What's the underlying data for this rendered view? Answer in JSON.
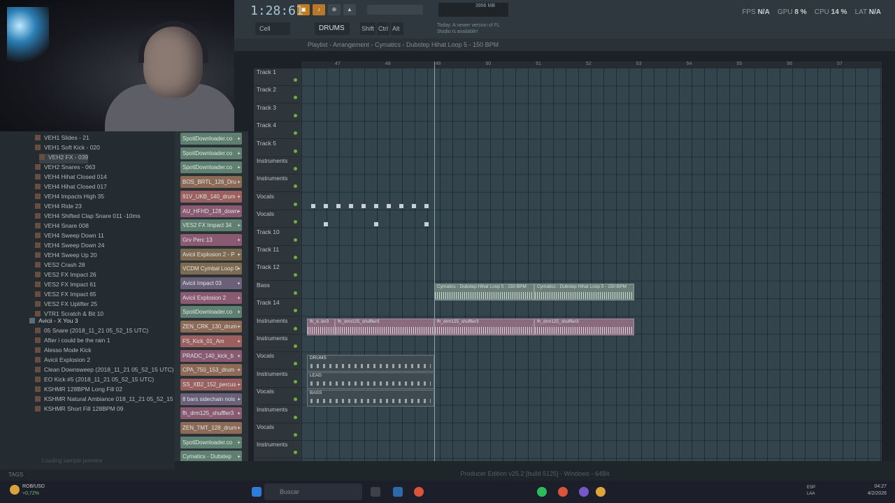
{
  "toolbar": {
    "time": "1:28:61",
    "pattern": "DRUMS",
    "cell": "Cell",
    "news": "Today: A newer version of FL Studio is available!",
    "fps_label": "FPS",
    "fps_value": "N/A",
    "gpu_label": "GPU",
    "gpu_value": "8 %",
    "cpu_label": "CPU",
    "cpu_value": "14 %",
    "lat_label": "LAT",
    "lat_value": "N/A",
    "mem": "3956 MB",
    "shift": "Shift",
    "ctrl": "Ctrl",
    "alt": "Alt"
  },
  "browser": {
    "items": [
      "VEH1 Slides - 21",
      "VEH1 Soft Kick - 020",
      "VEH2 FX - 039",
      "VEH2 Snares - 063",
      "VEH4 Hihat Closed 014",
      "VEH4 Hihat Closed 017",
      "VEH4 Impacts High 35",
      "VEH4 Ride 23",
      "VEH4 Shifted Clap Snare 011 -10ms",
      "VEH4 Snare 008",
      "VEH4 Sweep Down 11",
      "VEH4 Sweep Down 24",
      "VEH4 Sweep Up 20",
      "VES2 Crash 28",
      "VES2 FX Impact 26",
      "VES2 FX Impact 61",
      "VES2 FX Impact 65",
      "VES2 FX Uplifter 25",
      "VTR1 Scratch & Bit 10"
    ],
    "folder": "Avicii - X You 3",
    "folder_items": [
      "05 Snare (2018_11_21 05_52_15 UTC)",
      "After i could be the rain 1",
      "Alesso Mode Kick",
      "Avicii Explosion 2",
      "Clean Downsweep (2018_11_21 05_52_15 UTC)",
      "EO Kick #5 (2018_11_21 05_52_15 UTC)",
      "KSHMR 128BPM Long Fill 02",
      "KSHMR Natural Ambiance 018_11_21 05_52_15 UTC)",
      "KSHMR Short Fill 128BPM 09"
    ],
    "footer": "TAGS",
    "loading": "Loading sample preview"
  },
  "rack": {
    "channels": [
      {
        "label": "SpotiDownloader.co",
        "color": "#5f7f70"
      },
      {
        "label": "SpotiDownloader.co",
        "color": "#5f7f70"
      },
      {
        "label": "SpotiDownloader.co",
        "color": "#5f7f70"
      },
      {
        "label": "BOS_BRTL_126_Dru",
        "color": "#8c6a55"
      },
      {
        "label": "91V_UKB_140_drum",
        "color": "#9a5f5f"
      },
      {
        "label": "AU_HFHD_128_down",
        "color": "#8a5a70"
      },
      {
        "label": "VES2 FX Impact 34",
        "color": "#5f7f70"
      },
      {
        "label": "Grv Perc 13",
        "color": "#8a5a70"
      },
      {
        "label": "Avicii Explosion 2 - P",
        "color": "#7d6a50"
      },
      {
        "label": "VCDM Cymbal Loop 0",
        "color": "#7d6a50"
      },
      {
        "label": "Avicii Impact 03",
        "color": "#6a6078"
      },
      {
        "label": "Avicii Explosion 2",
        "color": "#8a5a70"
      },
      {
        "label": "SpotiDownloader.co",
        "color": "#5f7f70"
      },
      {
        "label": "ZEN_CRK_130_drum",
        "color": "#8c6a55"
      },
      {
        "label": "FS_Kick_01_Am",
        "color": "#9a5f5f"
      },
      {
        "label": "PRADC_140_kick_b",
        "color": "#8a5a70"
      },
      {
        "label": "CPA_750_153_drum",
        "color": "#8c6a55"
      },
      {
        "label": "SS_XB2_152_percus",
        "color": "#9a5f5f"
      },
      {
        "label": "8 bars sidechain nois",
        "color": "#6a6078"
      },
      {
        "label": "fh_drm125_shuffler3",
        "color": "#8a5a70"
      },
      {
        "label": "ZEN_TMT_128_drum",
        "color": "#8c6a55"
      },
      {
        "label": "SpotiDownloader.co",
        "color": "#5f7f70"
      },
      {
        "label": "Cymatics - Dubstep",
        "color": "#5f7f70"
      }
    ]
  },
  "playlist": {
    "title": "Playlist - Arrangement - Cymatics - Dubstep Hihat Loop 5 - 150 BPM",
    "ruler": [
      "47",
      "48",
      "49",
      "50",
      "51",
      "52",
      "53",
      "54",
      "55",
      "56",
      "57"
    ],
    "tracks": [
      "Track 1",
      "Track 2",
      "Track 3",
      "Track 4",
      "Track 5",
      "Instruments",
      "Instruments",
      "Vocals",
      "Vocals",
      "Track 10",
      "Track 11",
      "Track 12",
      "Bass",
      "Track 14",
      "Instruments",
      "Instruments",
      "Vocals",
      "Instruments",
      "Vocals",
      "Instruments",
      "Vocals",
      "Instruments"
    ],
    "clips": {
      "hihat_a": "Cymatics - Dubstep Hihat Loop 5 - 150 BPM",
      "hihat_b": "Cymatics - Dubstep Hihat Loop 5 - 150 BPM",
      "shuffler_a": "fh_d..ler3",
      "shuffler_b": "fh_drm125_shuffler3",
      "shuffler_c": "fh_drm125_shuffler3",
      "shuffler_d": "fh_drm125_shuffler3",
      "drums": "DRUMS",
      "lead": "LEAD",
      "bass": "BASS"
    }
  },
  "status": "Producer Edition v25.2 [build 5125] - Windows - 64Bit",
  "taskbar": {
    "ticker_a": "ROB/USD",
    "ticker_b": "+0,72%",
    "search": "Buscar",
    "lang_a": "ESP",
    "lang_b": "LAA",
    "time": "04:27",
    "date": "4/2/2026"
  }
}
